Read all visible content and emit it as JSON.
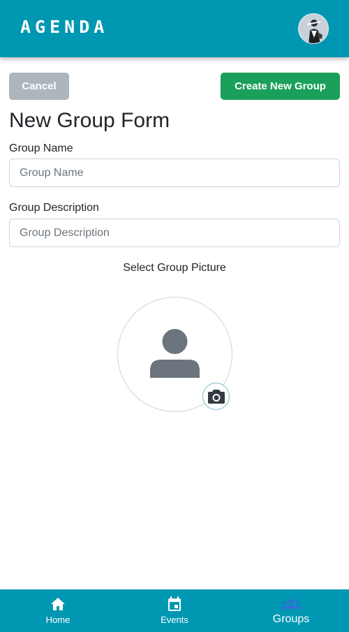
{
  "header": {
    "brand": "AGENDA",
    "avatar_icon": "user-avatar-photo"
  },
  "actions": {
    "cancel_label": "Cancel",
    "create_label": "Create New Group"
  },
  "form": {
    "title": "New Group Form",
    "group_name": {
      "label": "Group Name",
      "placeholder": "Group Name",
      "value": ""
    },
    "group_description": {
      "label": "Group Description",
      "placeholder": "Group Description",
      "value": ""
    },
    "picture": {
      "caption": "Select Group Picture",
      "placeholder_icon": "person-silhouette-icon",
      "camera_icon": "camera-icon"
    }
  },
  "bottom_nav": {
    "items": [
      {
        "label": "Home",
        "icon": "home-icon",
        "active": false
      },
      {
        "label": "Events",
        "icon": "calendar-icon",
        "active": false
      },
      {
        "label": "Groups",
        "icon": "groups-icon",
        "active": true
      }
    ]
  },
  "colors": {
    "brand": "#0097b2",
    "create_button": "#1aa05a",
    "cancel_button": "#adb5bd",
    "active_nav_icon": "#2f6fd6"
  }
}
